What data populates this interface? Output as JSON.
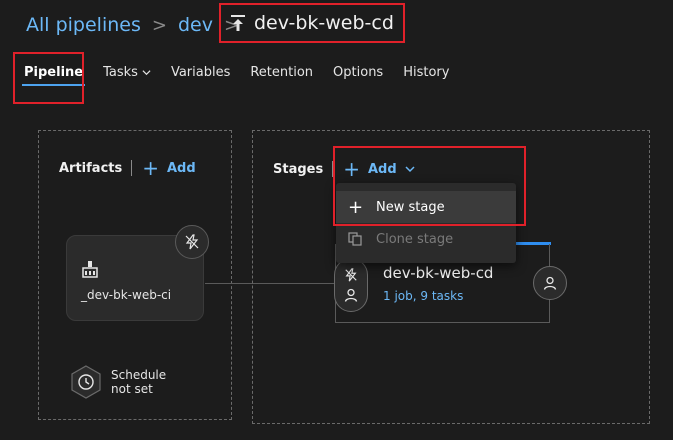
{
  "breadcrumb": {
    "items": [
      "All pipelines",
      "dev"
    ],
    "pipeline_name": "dev-bk-web-cd"
  },
  "tabs": [
    {
      "label": "Pipeline",
      "active": true
    },
    {
      "label": "Tasks",
      "dropdown": true
    },
    {
      "label": "Variables"
    },
    {
      "label": "Retention"
    },
    {
      "label": "Options"
    },
    {
      "label": "History"
    }
  ],
  "artifacts": {
    "title": "Artifacts",
    "add_label": "Add",
    "artifact_name": "_dev-bk-web-ci",
    "schedule_line1": "Schedule",
    "schedule_line2": "not set"
  },
  "stages": {
    "title": "Stages",
    "add_label": "Add",
    "stage_name": "dev-bk-web-cd",
    "stage_summary": "1 job, 9 tasks"
  },
  "add_menu": {
    "items": [
      {
        "label": "New stage",
        "highlighted": true
      },
      {
        "label": "Clone stage",
        "disabled": true
      }
    ]
  },
  "colors": {
    "background": "#1c1c1c",
    "accent": "#6cb8f6",
    "highlight_box": "#e0212a",
    "stage_bar": "#2f8ef0"
  },
  "icons": [
    "pipeline-release-icon",
    "lightning-icon",
    "build-icon",
    "clock-icon",
    "person-icon",
    "plus-icon",
    "chevron-down-icon",
    "clone-icon"
  ]
}
